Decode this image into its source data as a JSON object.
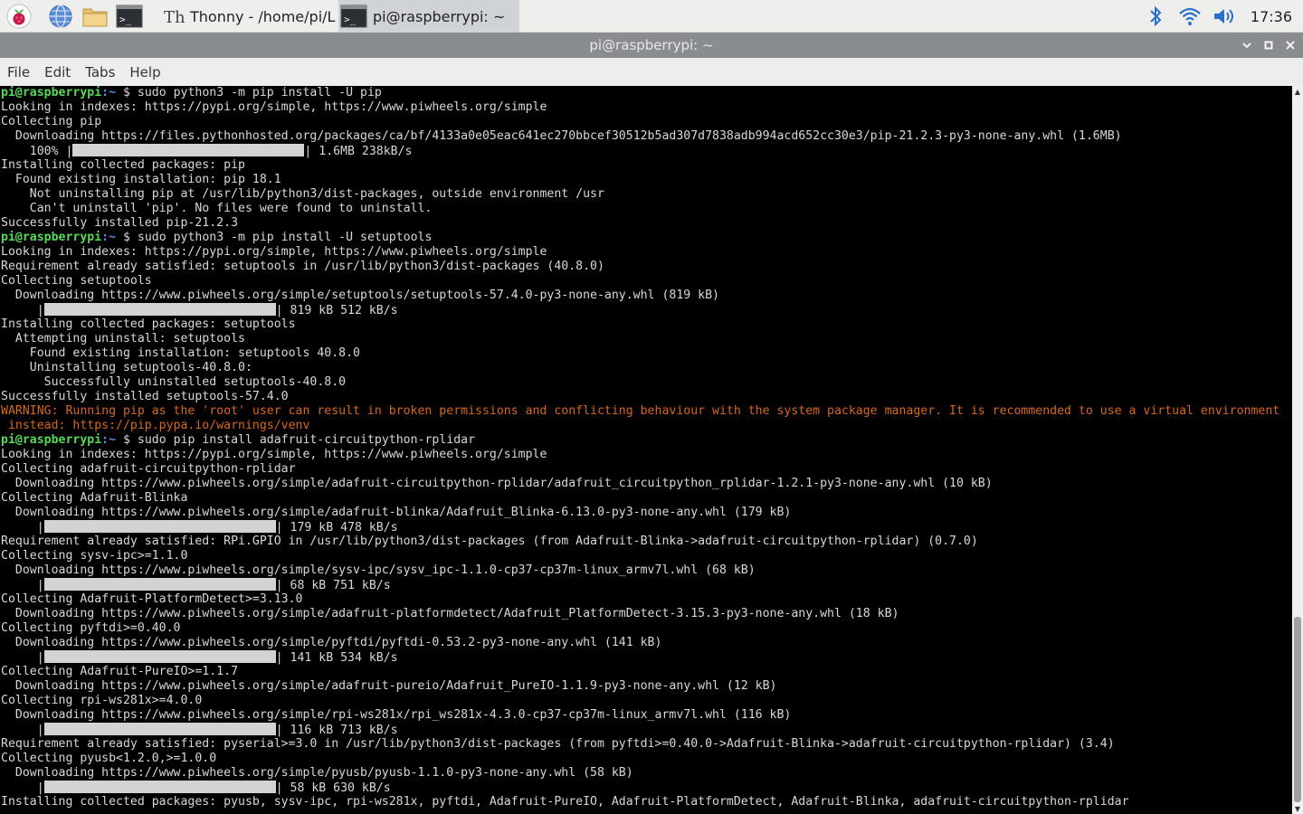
{
  "taskbar": {
    "launchers": [
      "raspberry-pi-menu",
      "web-browser",
      "file-manager",
      "terminal"
    ],
    "tasks": [
      {
        "label": "Thonny  -  /home/pi/L...",
        "active": false
      },
      {
        "label": "pi@raspberrypi: ~",
        "active": true
      }
    ],
    "tray": {
      "icons": [
        "bluetooth-icon",
        "wifi-icon",
        "volume-icon"
      ],
      "clock": "17:36"
    }
  },
  "window": {
    "title": "pi@raspberrypi: ~",
    "controls": [
      "minimize",
      "maximize",
      "close"
    ]
  },
  "menubar": {
    "items": [
      "File",
      "Edit",
      "Tabs",
      "Help"
    ]
  },
  "colors": {
    "prompt_user": "#5bd85b",
    "prompt_path": "#5c8ee6",
    "warning": "#d4691f",
    "text": "#d8d8d8",
    "background": "#000000"
  },
  "prompt": {
    "user": "pi@raspberrypi",
    "path": ":~",
    "symbol": " $ "
  },
  "terminal": {
    "lines": [
      {
        "type": "cmd",
        "text": "sudo python3 -m pip install -U pip"
      },
      {
        "type": "text",
        "text": "Looking in indexes: https://pypi.org/simple, https://www.piwheels.org/simple"
      },
      {
        "type": "text",
        "text": "Collecting pip"
      },
      {
        "type": "text",
        "text": "  Downloading https://files.pythonhosted.org/packages/ca/bf/4133a0e05eac641ec270bbcef30512b5ad307d7838adb994acd652cc30e3/pip-21.2.3-py3-none-any.whl (1.6MB)"
      },
      {
        "type": "progress",
        "prefix": "    100% |",
        "cells": 32,
        "suffix": "| 1.6MB 238kB/s"
      },
      {
        "type": "text",
        "text": "Installing collected packages: pip"
      },
      {
        "type": "text",
        "text": "  Found existing installation: pip 18.1"
      },
      {
        "type": "text",
        "text": "    Not uninstalling pip at /usr/lib/python3/dist-packages, outside environment /usr"
      },
      {
        "type": "text",
        "text": "    Can't uninstall 'pip'. No files were found to uninstall."
      },
      {
        "type": "text",
        "text": "Successfully installed pip-21.2.3"
      },
      {
        "type": "cmd",
        "text": "sudo python3 -m pip install -U setuptools"
      },
      {
        "type": "text",
        "text": "Looking in indexes: https://pypi.org/simple, https://www.piwheels.org/simple"
      },
      {
        "type": "text",
        "text": "Requirement already satisfied: setuptools in /usr/lib/python3/dist-packages (40.8.0)"
      },
      {
        "type": "text",
        "text": "Collecting setuptools"
      },
      {
        "type": "text",
        "text": "  Downloading https://www.piwheels.org/simple/setuptools/setuptools-57.4.0-py3-none-any.whl (819 kB)"
      },
      {
        "type": "progress",
        "prefix": "     |",
        "cells": 32,
        "suffix": "| 819 kB 512 kB/s"
      },
      {
        "type": "text",
        "text": "Installing collected packages: setuptools"
      },
      {
        "type": "text",
        "text": "  Attempting uninstall: setuptools"
      },
      {
        "type": "text",
        "text": "    Found existing installation: setuptools 40.8.0"
      },
      {
        "type": "text",
        "text": "    Uninstalling setuptools-40.8.0:"
      },
      {
        "type": "text",
        "text": "      Successfully uninstalled setuptools-40.8.0"
      },
      {
        "type": "text",
        "text": "Successfully installed setuptools-57.4.0"
      },
      {
        "type": "warn",
        "text": "WARNING: Running pip as the 'root' user can result in broken permissions and conflicting behaviour with the system package manager. It is recommended to use a virtual environment"
      },
      {
        "type": "warn",
        "text": " instead: https://pip.pypa.io/warnings/venv"
      },
      {
        "type": "cmd",
        "text": "sudo pip install adafruit-circuitpython-rplidar"
      },
      {
        "type": "text",
        "text": "Looking in indexes: https://pypi.org/simple, https://www.piwheels.org/simple"
      },
      {
        "type": "text",
        "text": "Collecting adafruit-circuitpython-rplidar"
      },
      {
        "type": "text",
        "text": "  Downloading https://www.piwheels.org/simple/adafruit-circuitpython-rplidar/adafruit_circuitpython_rplidar-1.2.1-py3-none-any.whl (10 kB)"
      },
      {
        "type": "text",
        "text": "Collecting Adafruit-Blinka"
      },
      {
        "type": "text",
        "text": "  Downloading https://www.piwheels.org/simple/adafruit-blinka/Adafruit_Blinka-6.13.0-py3-none-any.whl (179 kB)"
      },
      {
        "type": "progress",
        "prefix": "     |",
        "cells": 32,
        "suffix": "| 179 kB 478 kB/s"
      },
      {
        "type": "text",
        "text": "Requirement already satisfied: RPi.GPIO in /usr/lib/python3/dist-packages (from Adafruit-Blinka->adafruit-circuitpython-rplidar) (0.7.0)"
      },
      {
        "type": "text",
        "text": "Collecting sysv-ipc>=1.1.0"
      },
      {
        "type": "text",
        "text": "  Downloading https://www.piwheels.org/simple/sysv-ipc/sysv_ipc-1.1.0-cp37-cp37m-linux_armv7l.whl (68 kB)"
      },
      {
        "type": "progress",
        "prefix": "     |",
        "cells": 32,
        "suffix": "| 68 kB 751 kB/s"
      },
      {
        "type": "text",
        "text": "Collecting Adafruit-PlatformDetect>=3.13.0"
      },
      {
        "type": "text",
        "text": "  Downloading https://www.piwheels.org/simple/adafruit-platformdetect/Adafruit_PlatformDetect-3.15.3-py3-none-any.whl (18 kB)"
      },
      {
        "type": "text",
        "text": "Collecting pyftdi>=0.40.0"
      },
      {
        "type": "text",
        "text": "  Downloading https://www.piwheels.org/simple/pyftdi/pyftdi-0.53.2-py3-none-any.whl (141 kB)"
      },
      {
        "type": "progress",
        "prefix": "     |",
        "cells": 32,
        "suffix": "| 141 kB 534 kB/s"
      },
      {
        "type": "text",
        "text": "Collecting Adafruit-PureIO>=1.1.7"
      },
      {
        "type": "text",
        "text": "  Downloading https://www.piwheels.org/simple/adafruit-pureio/Adafruit_PureIO-1.1.9-py3-none-any.whl (12 kB)"
      },
      {
        "type": "text",
        "text": "Collecting rpi-ws281x>=4.0.0"
      },
      {
        "type": "text",
        "text": "  Downloading https://www.piwheels.org/simple/rpi-ws281x/rpi_ws281x-4.3.0-cp37-cp37m-linux_armv7l.whl (116 kB)"
      },
      {
        "type": "progress",
        "prefix": "     |",
        "cells": 32,
        "suffix": "| 116 kB 713 kB/s"
      },
      {
        "type": "text",
        "text": "Requirement already satisfied: pyserial>=3.0 in /usr/lib/python3/dist-packages (from pyftdi>=0.40.0->Adafruit-Blinka->adafruit-circuitpython-rplidar) (3.4)"
      },
      {
        "type": "text",
        "text": "Collecting pyusb<1.2.0,>=1.0.0"
      },
      {
        "type": "text",
        "text": "  Downloading https://www.piwheels.org/simple/pyusb/pyusb-1.1.0-py3-none-any.whl (58 kB)"
      },
      {
        "type": "progress",
        "prefix": "     |",
        "cells": 32,
        "suffix": "| 58 kB 630 kB/s"
      },
      {
        "type": "text",
        "text": "Installing collected packages: pyusb, sysv-ipc, rpi-ws281x, pyftdi, Adafruit-PureIO, Adafruit-PlatformDetect, Adafruit-Blinka, adafruit-circuitpython-rplidar"
      }
    ]
  }
}
